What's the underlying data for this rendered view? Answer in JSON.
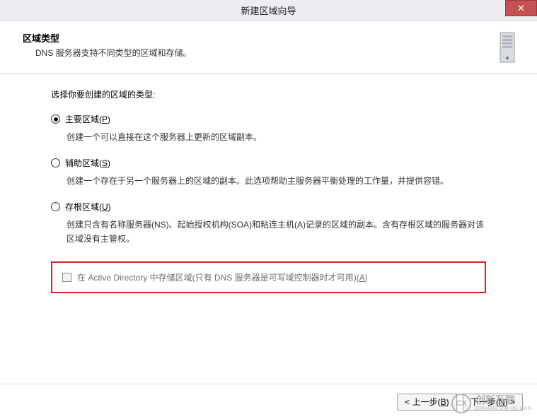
{
  "window": {
    "title": "新建区域向导",
    "close_glyph": "✕"
  },
  "header": {
    "title": "区域类型",
    "desc": "DNS 服务器支持不同类型的区域和存储。"
  },
  "content": {
    "prompt": "选择你要创建的区域的类型:",
    "options": [
      {
        "label_pre": "主要区域(",
        "accel": "P",
        "label_post": ")",
        "desc": "创建一个可以直接在这个服务器上更新的区域副本。",
        "selected": true
      },
      {
        "label_pre": "辅助区域(",
        "accel": "S",
        "label_post": ")",
        "desc": "创建一个存在于另一个服务器上的区域的副本。此选项帮助主服务器平衡处理的工作量，并提供容错。",
        "selected": false
      },
      {
        "label_pre": "存根区域(",
        "accel": "U",
        "label_post": ")",
        "desc": "创建只含有名称服务器(NS)、起始授权机构(SOA)和粘连主机(A)记录的区域的副本。含有存根区域的服务器对该区域没有主管权。",
        "selected": false
      }
    ],
    "ad_checkbox": {
      "label_pre": "在 Active Directory 中存储区域(只有 DNS 服务器是可写域控制器时才可用)(",
      "accel": "A",
      "label_post": ")",
      "enabled": false,
      "checked": false
    }
  },
  "footer": {
    "back_pre": "< 上一步(",
    "back_accel": "B",
    "back_post": ")",
    "next_pre": "下一步(",
    "next_accel": "N",
    "next_post": ") >"
  },
  "watermark": {
    "icon_text": "CX",
    "line1": "创新互联",
    "line2": "CHUANG XIN HU LIAN"
  }
}
